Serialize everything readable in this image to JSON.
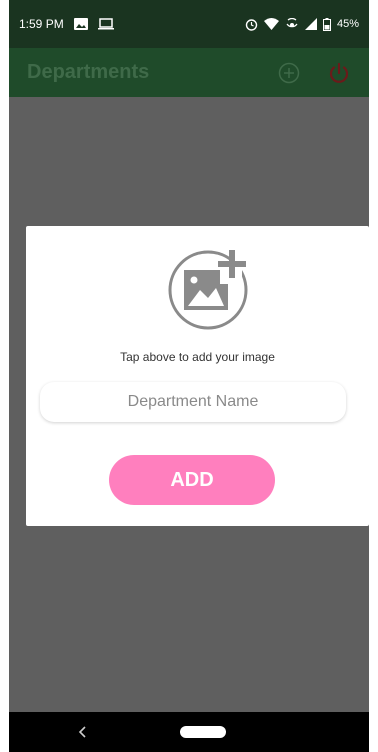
{
  "status_bar": {
    "time": "1:59 PM",
    "battery": "45%",
    "icons": [
      "image-notification-icon",
      "screen-notification-icon",
      "alarm-icon",
      "wifi-icon",
      "hotspot-icon",
      "signal-icon",
      "battery-icon"
    ]
  },
  "app_bar": {
    "title": "Departments",
    "actions": [
      "add-circle-icon",
      "power-icon"
    ]
  },
  "dialog": {
    "image_picker_icon": "add-photo-icon",
    "hint": "Tap above to add your image",
    "name_placeholder": "Department Name",
    "name_value": "",
    "add_label": "ADD"
  },
  "nav_bar": {
    "buttons": [
      "back-icon",
      "home-pill"
    ]
  },
  "colors": {
    "status_bar": "#1a3420",
    "app_bar": "#1f4b2a",
    "overlay": "#5f5f5f",
    "add_button": "#ff7fbe",
    "dialog_bg": "#ffffff"
  }
}
